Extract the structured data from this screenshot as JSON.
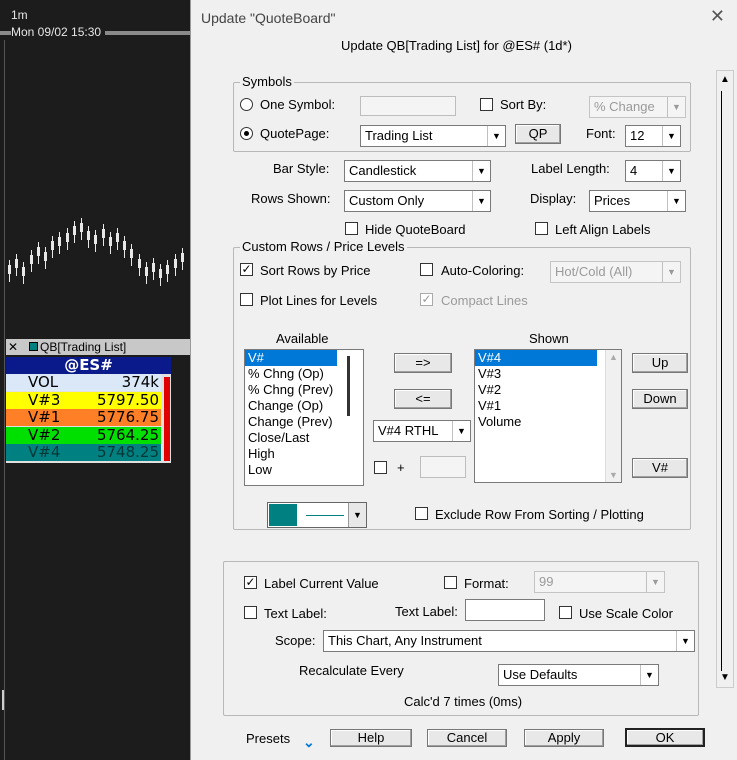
{
  "chart": {
    "interval": "1m",
    "datetime": "Mon 09/02 15:30"
  },
  "quoteboard": {
    "header_label": "QB[Trading List]",
    "symbol": "@ES#",
    "rows": [
      {
        "label": "VOL",
        "value": "374k",
        "bg": "#dbe8f8",
        "fg": "#000000"
      },
      {
        "label": "V#3",
        "value": "5797.50",
        "bg": "#ffff00",
        "fg": "#000000"
      },
      {
        "label": "V#1",
        "value": "5776.75",
        "bg": "#ff7f27",
        "fg": "#000000"
      },
      {
        "label": "V#2",
        "value": "5764.25",
        "bg": "#00e000",
        "fg": "#000000"
      },
      {
        "label": "V#4",
        "value": "5748.25",
        "bg": "#008080",
        "fg": "#003838"
      }
    ]
  },
  "dialog": {
    "title": "Update \"QuoteBoard\"",
    "subtitle": "Update QB[Trading List] for @ES# (1d*)",
    "symbols": {
      "group_label": "Symbols",
      "one_symbol_label": "One Symbol:",
      "quotepage_label": "QuotePage:",
      "quotepage_value": "Trading List",
      "qp_button": "QP",
      "sort_by_label": "Sort By:",
      "sort_by_value": "% Change",
      "font_label": "Font:",
      "font_value": "12"
    },
    "bar_style_label": "Bar Style:",
    "bar_style_value": "Candlestick",
    "label_length_label": "Label Length:",
    "label_length_value": "4",
    "rows_shown_label": "Rows Shown:",
    "rows_shown_value": "Custom Only",
    "display_label": "Display:",
    "display_value": "Prices",
    "hide_quoteboard_label": "Hide QuoteBoard",
    "left_align_label": "Left Align Labels",
    "custom_rows": {
      "group_label": "Custom Rows / Price Levels",
      "sort_rows_label": "Sort Rows by Price",
      "auto_coloring_label": "Auto-Coloring:",
      "auto_coloring_value": "Hot/Cold (All)",
      "plot_lines_label": "Plot Lines for Levels",
      "compact_lines_label": "Compact Lines",
      "available_header": "Available",
      "shown_header": "Shown",
      "available_items": [
        "V#",
        "% Chng (Op)",
        "% Chng (Prev)",
        "Change (Op)",
        "Change (Prev)",
        "Close/Last",
        "High",
        "Low"
      ],
      "shown_items": [
        "V#4",
        "V#3",
        "V#2",
        "V#1",
        "Volume"
      ],
      "add_button": "=>",
      "remove_button": "<=",
      "row_select_value": "V#4  RTHL",
      "plus_label": "+",
      "up_button": "Up",
      "down_button": "Down",
      "vhash_button": "V#",
      "exclude_label": "Exclude Row From Sorting / Plotting",
      "line_color": "#008080"
    },
    "bottom": {
      "label_current_value": "Label Current Value",
      "format_label": "Format:",
      "format_value": "99",
      "text_label_check": "Text Label:",
      "text_label_field_label": "Text Label:",
      "use_scale_color": "Use Scale Color",
      "scope_label": "Scope:",
      "scope_value": "This Chart, Any Instrument",
      "recalc_label": "Recalculate Every",
      "recalc_value": "Use Defaults",
      "calc_status": "Calc'd 7 times (0ms)"
    },
    "footer": {
      "presets": "Presets",
      "help": "Help",
      "cancel": "Cancel",
      "apply": "Apply",
      "ok": "OK"
    }
  }
}
